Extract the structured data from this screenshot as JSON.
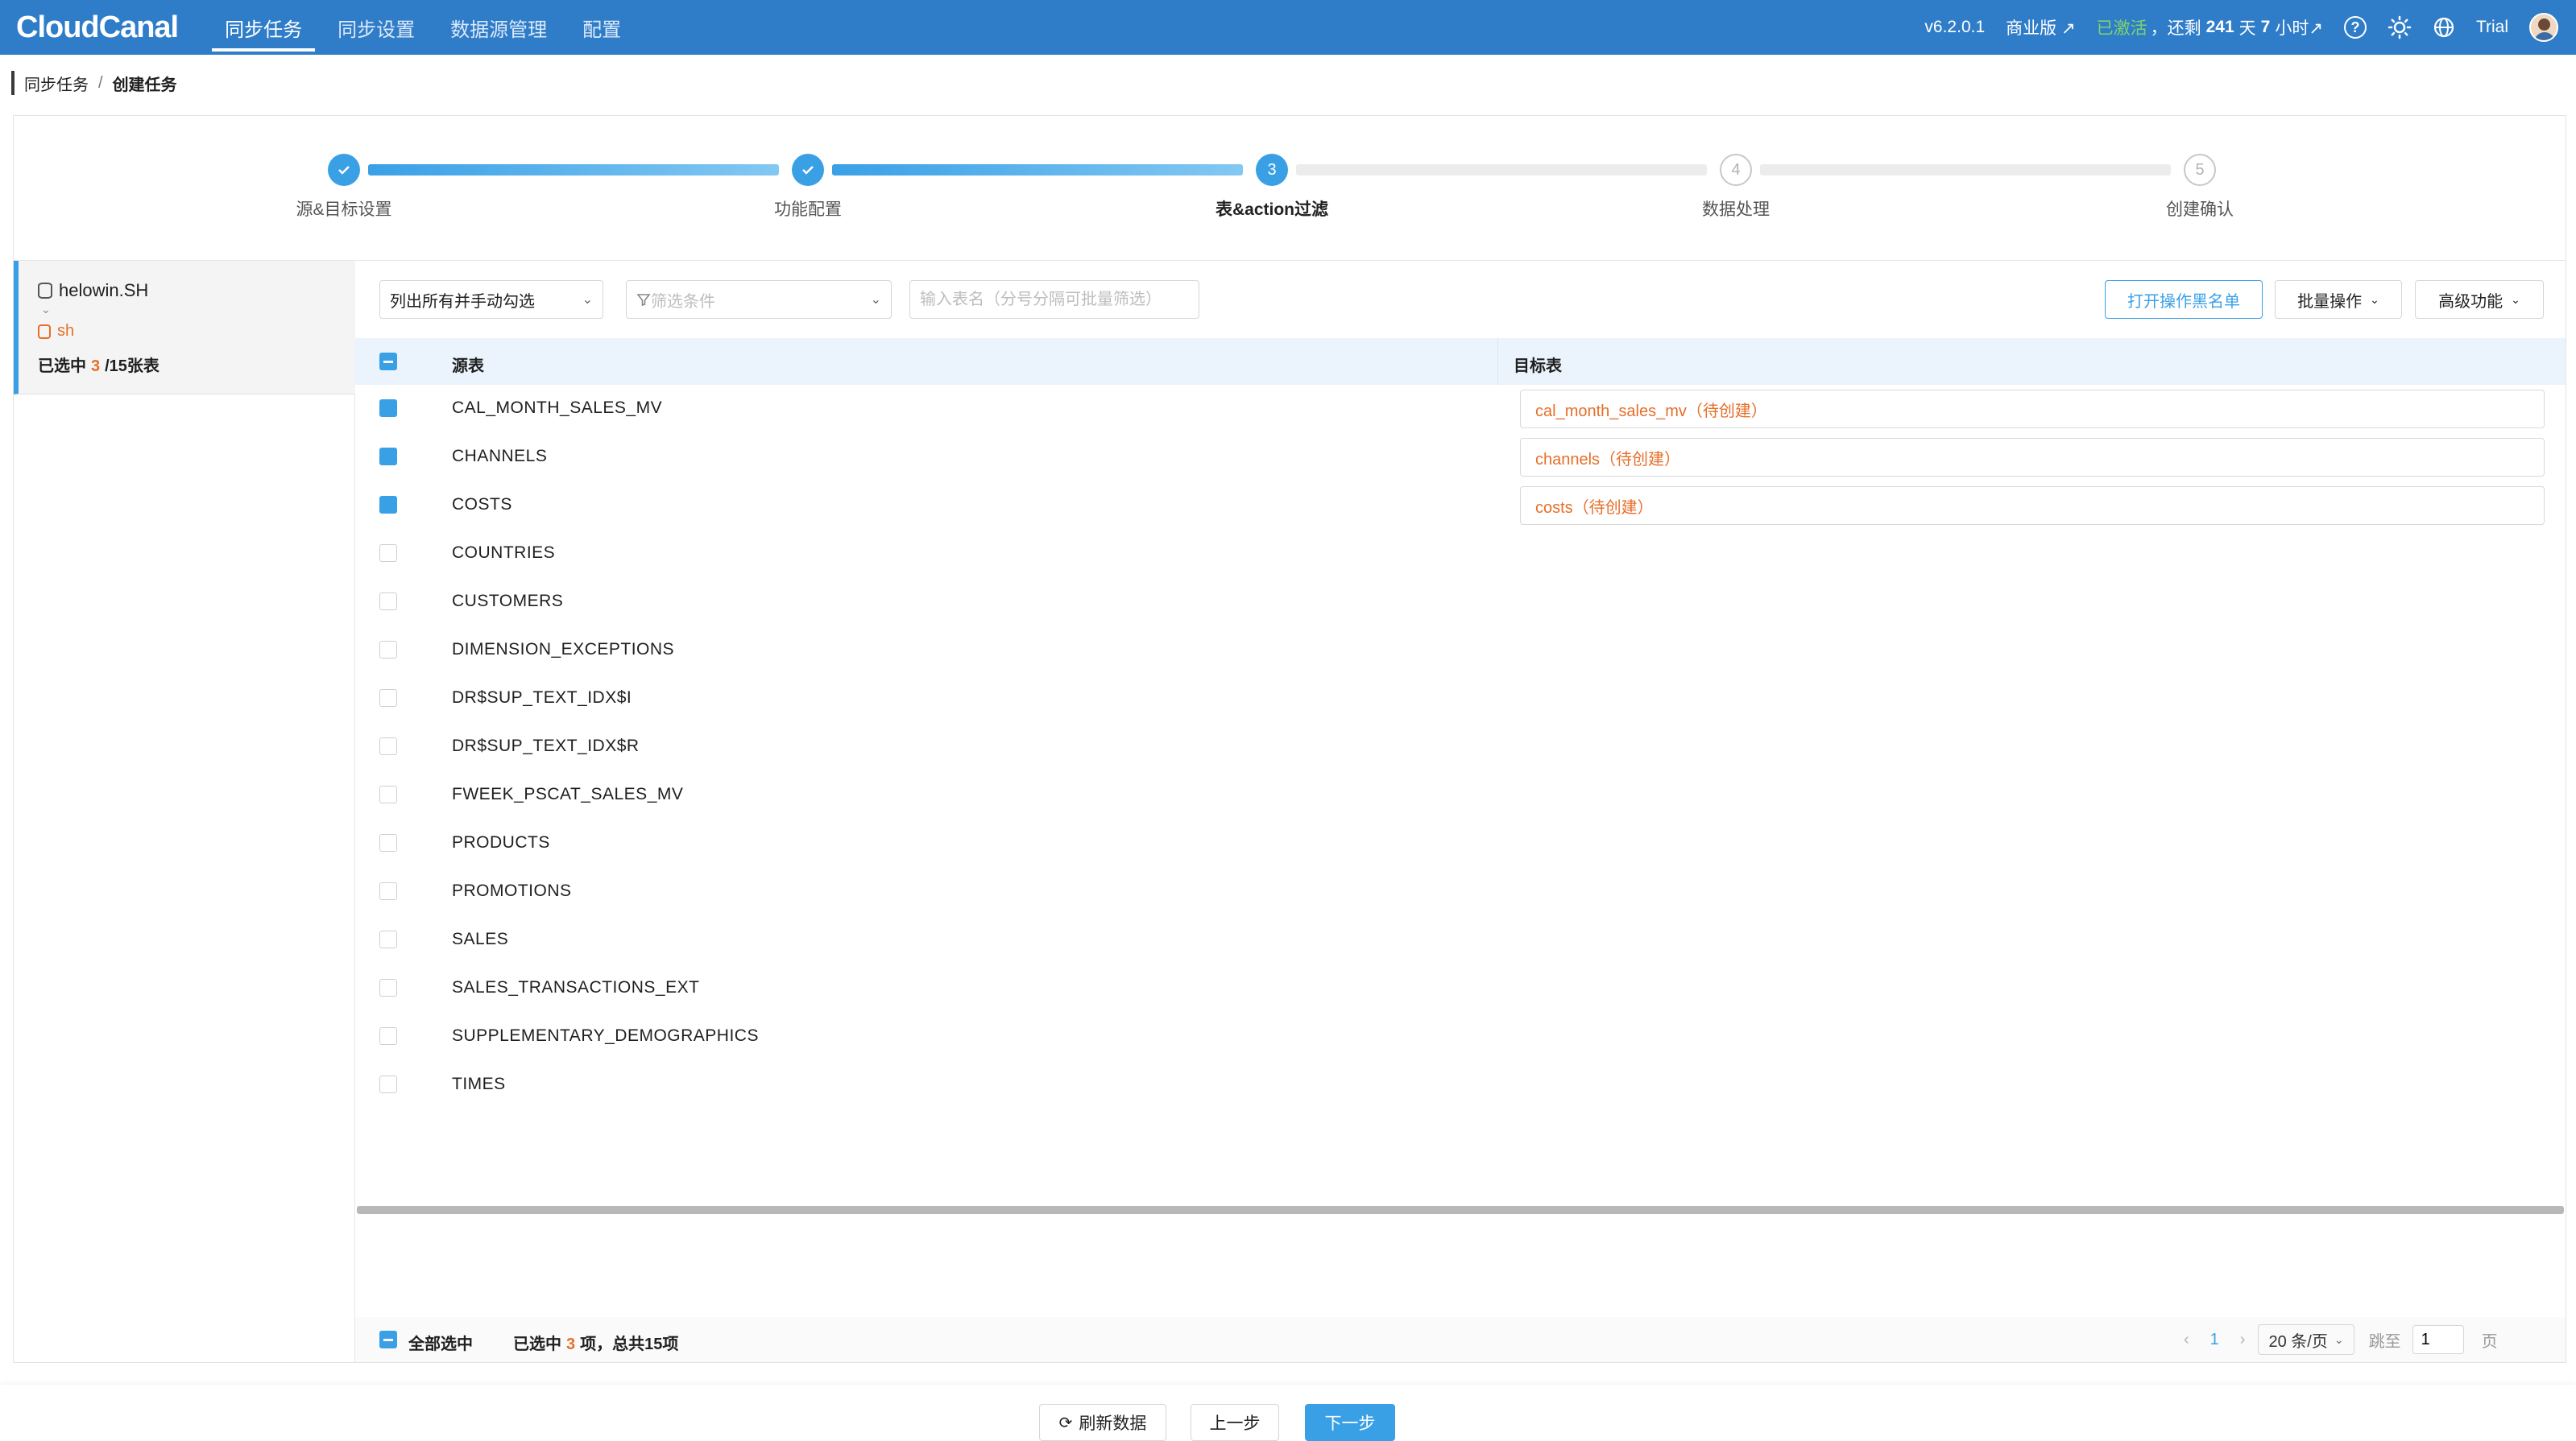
{
  "header": {
    "logo": "CloudCanal",
    "nav": [
      {
        "label": "同步任务",
        "active": true
      },
      {
        "label": "同步设置",
        "active": false
      },
      {
        "label": "数据源管理",
        "active": false
      },
      {
        "label": "配置",
        "active": false
      }
    ],
    "version": "v6.2.0.1",
    "edition": "商业版 ↗",
    "activation": "已激活",
    "remain_prefix": "，还剩",
    "remain_days": "241",
    "remain_mid": "天",
    "remain_hours": "7",
    "remain_suffix": "小时↗",
    "help_icon": "?",
    "user": "Trial"
  },
  "breadcrumb": {
    "parent": "同步任务",
    "separator": "/",
    "current": "创建任务"
  },
  "steps": [
    {
      "label": "源&目标设置",
      "state": "done",
      "number": "1"
    },
    {
      "label": "功能配置",
      "state": "done",
      "number": "2"
    },
    {
      "label": "表&action过滤",
      "state": "current",
      "number": "3"
    },
    {
      "label": "数据处理",
      "state": "todo",
      "number": "4"
    },
    {
      "label": "创建确认",
      "state": "todo",
      "number": "5"
    }
  ],
  "left": {
    "db_name": "helowin.SH",
    "schema": "sh",
    "selected_prefix": "已选中",
    "selected_count": "3",
    "selected_suffix": "/15张表"
  },
  "toolbar": {
    "mode_select": "列出所有并手动勾选",
    "filter_placeholder": "筛选条件",
    "search_placeholder": "输入表名（分号分隔可批量筛选）",
    "blacklist_button": "打开操作黑名单",
    "batch_button": "批量操作",
    "advanced_button": "高级功能"
  },
  "table": {
    "col_source": "源表",
    "col_target": "目标表",
    "rows": [
      {
        "source": "CAL_MONTH_SALES_MV",
        "checked": true,
        "target": "cal_month_sales_mv（待创建）"
      },
      {
        "source": "CHANNELS",
        "checked": true,
        "target": "channels（待创建）"
      },
      {
        "source": "COSTS",
        "checked": true,
        "target": "costs（待创建）"
      },
      {
        "source": "COUNTRIES",
        "checked": false,
        "target": ""
      },
      {
        "source": "CUSTOMERS",
        "checked": false,
        "target": ""
      },
      {
        "source": "DIMENSION_EXCEPTIONS",
        "checked": false,
        "target": ""
      },
      {
        "source": "DR$SUP_TEXT_IDX$I",
        "checked": false,
        "target": ""
      },
      {
        "source": "DR$SUP_TEXT_IDX$R",
        "checked": false,
        "target": ""
      },
      {
        "source": "FWEEK_PSCAT_SALES_MV",
        "checked": false,
        "target": ""
      },
      {
        "source": "PRODUCTS",
        "checked": false,
        "target": ""
      },
      {
        "source": "PROMOTIONS",
        "checked": false,
        "target": ""
      },
      {
        "source": "SALES",
        "checked": false,
        "target": ""
      },
      {
        "source": "SALES_TRANSACTIONS_EXT",
        "checked": false,
        "target": ""
      },
      {
        "source": "SUPPLEMENTARY_DEMOGRAPHICS",
        "checked": false,
        "target": ""
      },
      {
        "source": "TIMES",
        "checked": false,
        "target": ""
      }
    ]
  },
  "footer": {
    "select_all": "全部选中",
    "selected_prefix": "已选中",
    "selected_count": "3",
    "selected_suffix": "项，总共15项",
    "page": "1",
    "page_size": "20 条/页",
    "jump_label": "跳至",
    "jump_value": "1",
    "page_unit": "页"
  },
  "actions": {
    "refresh": "刷新数据",
    "prev": "上一步",
    "next": "下一步"
  },
  "colors": {
    "accent": "#3aa0e6",
    "header": "#2f7dc9",
    "pending": "#e66f2a",
    "active_status": "#7ed36b"
  }
}
